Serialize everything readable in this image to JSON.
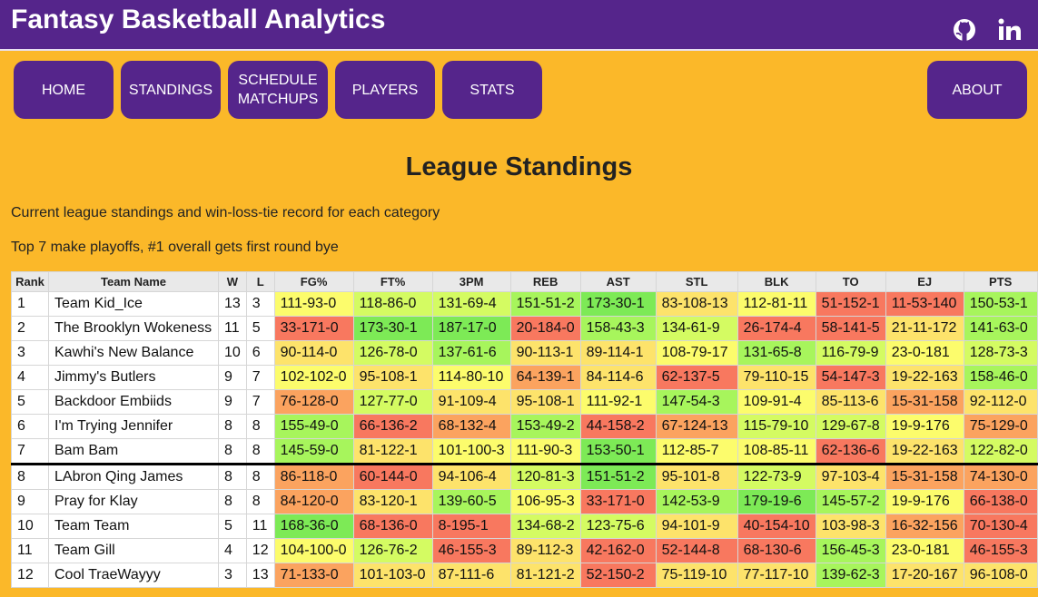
{
  "header": {
    "title": "Fantasy Basketball Analytics",
    "icons": [
      "github-icon",
      "linkedin-icon"
    ]
  },
  "nav": {
    "home": "HOME",
    "standings": "STANDINGS",
    "schedule_line1": "SCHEDULE",
    "schedule_line2": "MATCHUPS",
    "players": "PLAYERS",
    "stats": "STATS",
    "about": "ABOUT"
  },
  "page": {
    "title": "League Standings",
    "desc1": "Current league standings and win-loss-tie record for each category",
    "desc2": "Top 7 make playoffs, #1 overall gets first round bye"
  },
  "colors": {
    "header_bg": "#55258b",
    "page_bg": "#fbb829",
    "nav_bg": "#55258b",
    "scale": [
      "#f8785f",
      "#fba35f",
      "#fde36b",
      "#fcfc6c",
      "#d4fb62",
      "#a7f55c",
      "#7dea56"
    ]
  },
  "table": {
    "headers": [
      "Rank",
      "Team Name",
      "W",
      "L",
      "FG%",
      "FT%",
      "3PM",
      "REB",
      "AST",
      "STL",
      "BLK",
      "TO",
      "EJ",
      "PTS"
    ],
    "playoff_cutoff_after_rank": 7,
    "rows": [
      {
        "rank": "1",
        "team": "Team Kid_Ice",
        "w": "13",
        "l": "3",
        "cats": [
          "111-93-0",
          "118-86-0",
          "131-69-4",
          "151-51-2",
          "173-30-1",
          "83-108-13",
          "112-81-11",
          "51-152-1",
          "11-53-140",
          "150-53-1"
        ],
        "levels": [
          4,
          5,
          5,
          6,
          7,
          3,
          4,
          1,
          1,
          6
        ]
      },
      {
        "rank": "2",
        "team": "The Brooklyn Wokeness",
        "w": "11",
        "l": "5",
        "cats": [
          "33-171-0",
          "173-30-1",
          "187-17-0",
          "20-184-0",
          "158-43-3",
          "134-61-9",
          "26-174-4",
          "58-141-5",
          "21-11-172",
          "141-63-0"
        ],
        "levels": [
          1,
          7,
          7,
          1,
          6,
          5,
          1,
          1,
          3,
          6
        ]
      },
      {
        "rank": "3",
        "team": "Kawhi's New Balance",
        "w": "10",
        "l": "6",
        "cats": [
          "90-114-0",
          "126-78-0",
          "137-61-6",
          "90-113-1",
          "89-114-1",
          "108-79-17",
          "131-65-8",
          "116-79-9",
          "23-0-181",
          "128-73-3"
        ],
        "levels": [
          3,
          5,
          6,
          3,
          3,
          4,
          6,
          5,
          4,
          5
        ]
      },
      {
        "rank": "4",
        "team": "Jimmy's Butlers",
        "w": "9",
        "l": "7",
        "cats": [
          "102-102-0",
          "95-108-1",
          "114-80-10",
          "64-139-1",
          "84-114-6",
          "62-137-5",
          "79-110-15",
          "54-147-3",
          "19-22-163",
          "158-46-0"
        ],
        "levels": [
          4,
          3,
          4,
          2,
          3,
          1,
          3,
          1,
          3,
          6
        ]
      },
      {
        "rank": "5",
        "team": "Backdoor Embiids",
        "w": "9",
        "l": "7",
        "cats": [
          "76-128-0",
          "127-77-0",
          "91-109-4",
          "95-108-1",
          "111-92-1",
          "147-54-3",
          "109-91-4",
          "85-113-6",
          "15-31-158",
          "92-112-0"
        ],
        "levels": [
          2,
          5,
          3,
          3,
          4,
          6,
          4,
          3,
          2,
          3
        ]
      },
      {
        "rank": "6",
        "team": "I'm Trying Jennifer",
        "w": "8",
        "l": "8",
        "cats": [
          "155-49-0",
          "66-136-2",
          "68-132-4",
          "153-49-2",
          "44-158-2",
          "67-124-13",
          "115-79-10",
          "129-67-8",
          "19-9-176",
          "75-129-0"
        ],
        "levels": [
          6,
          1,
          2,
          6,
          1,
          2,
          5,
          5,
          4,
          2
        ]
      },
      {
        "rank": "7",
        "team": "Bam Bam",
        "w": "8",
        "l": "8",
        "cats": [
          "145-59-0",
          "81-122-1",
          "101-100-3",
          "111-90-3",
          "153-50-1",
          "112-85-7",
          "108-85-11",
          "62-136-6",
          "19-22-163",
          "122-82-0"
        ],
        "levels": [
          6,
          3,
          4,
          4,
          7,
          4,
          4,
          1,
          3,
          5
        ]
      },
      {
        "rank": "8",
        "team": "LAbron Qing James",
        "w": "8",
        "l": "8",
        "cats": [
          "86-118-0",
          "60-144-0",
          "94-106-4",
          "120-81-3",
          "151-51-2",
          "95-101-8",
          "122-73-9",
          "97-103-4",
          "15-31-158",
          "74-130-0"
        ],
        "levels": [
          2,
          1,
          3,
          5,
          7,
          3,
          5,
          3,
          2,
          2
        ]
      },
      {
        "rank": "9",
        "team": "Pray for Klay",
        "w": "8",
        "l": "8",
        "cats": [
          "84-120-0",
          "83-120-1",
          "139-60-5",
          "106-95-3",
          "33-171-0",
          "142-53-9",
          "179-19-6",
          "145-57-2",
          "19-9-176",
          "66-138-0"
        ],
        "levels": [
          2,
          3,
          6,
          4,
          1,
          6,
          7,
          6,
          4,
          1
        ]
      },
      {
        "rank": "10",
        "team": "Team Team",
        "w": "5",
        "l": "11",
        "cats": [
          "168-36-0",
          "68-136-0",
          "8-195-1",
          "134-68-2",
          "123-75-6",
          "94-101-9",
          "40-154-10",
          "103-98-3",
          "16-32-156",
          "70-130-4"
        ],
        "levels": [
          7,
          1,
          1,
          5,
          5,
          3,
          1,
          3,
          2,
          1
        ]
      },
      {
        "rank": "11",
        "team": "Team Gill",
        "w": "4",
        "l": "12",
        "cats": [
          "104-100-0",
          "126-76-2",
          "46-155-3",
          "89-112-3",
          "42-162-0",
          "52-144-8",
          "68-130-6",
          "156-45-3",
          "23-0-181",
          "46-155-3"
        ],
        "levels": [
          4,
          5,
          1,
          3,
          1,
          1,
          1,
          6,
          4,
          1
        ]
      },
      {
        "rank": "12",
        "team": "Cool TraeWayyy",
        "w": "3",
        "l": "13",
        "cats": [
          "71-133-0",
          "101-103-0",
          "87-111-6",
          "81-121-2",
          "52-150-2",
          "75-119-10",
          "77-117-10",
          "139-62-3",
          "17-20-167",
          "96-108-0"
        ],
        "levels": [
          2,
          3,
          3,
          3,
          1,
          3,
          3,
          6,
          3,
          3
        ]
      }
    ]
  }
}
